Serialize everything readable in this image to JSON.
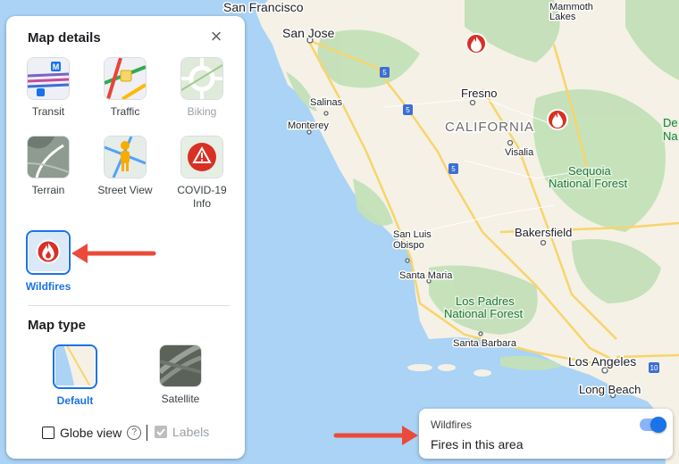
{
  "map": {
    "cities": [
      {
        "name": "San Francisco",
        "cls": "big"
      },
      {
        "name": "San Jose",
        "cls": "big"
      },
      {
        "name": "Mammoth",
        "cls": "small"
      },
      {
        "name": "Lakes",
        "cls": "small"
      },
      {
        "name": "Fresno",
        "cls": ""
      },
      {
        "name": "Salinas",
        "cls": "small"
      },
      {
        "name": "Monterey",
        "cls": "small"
      },
      {
        "name": "Visalia",
        "cls": "small"
      },
      {
        "name": "Bakersfield",
        "cls": ""
      },
      {
        "name": "San Luis",
        "cls": "small"
      },
      {
        "name": "Obispo",
        "cls": "small"
      },
      {
        "name": "Santa Maria",
        "cls": "small"
      },
      {
        "name": "Santa Barbara",
        "cls": "small"
      },
      {
        "name": "Los Angeles",
        "cls": "big"
      },
      {
        "name": "Long Beach",
        "cls": ""
      },
      {
        "name": "De",
        "cls": ""
      },
      {
        "name": "Na",
        "cls": ""
      }
    ],
    "state_label": "CALIFORNIA",
    "parks": [
      "Sequoia",
      "National Forest",
      "Los Padres",
      "National Forest"
    ],
    "highway_shields": [
      "5",
      "5",
      "5",
      "10"
    ]
  },
  "panel": {
    "title": "Map details",
    "close_glyph": "×",
    "details": [
      {
        "label": "Transit",
        "state": "normal"
      },
      {
        "label": "Traffic",
        "state": "normal"
      },
      {
        "label": "Biking",
        "state": "disabled"
      },
      {
        "label": "Terrain",
        "state": "normal"
      },
      {
        "label": "Street View",
        "state": "normal"
      },
      {
        "label": "COVID-19 Info",
        "state": "normal"
      },
      {
        "label": "Wildfires",
        "state": "active"
      }
    ],
    "map_type_title": "Map type",
    "map_types": [
      {
        "label": "Default",
        "selected": true
      },
      {
        "label": "Satellite",
        "selected": false
      }
    ],
    "globe_view": {
      "label": "Globe view",
      "checked": false,
      "help_glyph": "?"
    },
    "labels": {
      "label": "Labels",
      "checked": true,
      "disabled": true
    }
  },
  "wildfire_card": {
    "label": "Wildfires",
    "description": "Fires in this area",
    "toggle_on": true
  },
  "colors": {
    "water": "#aad3f5",
    "land": "#f5f1e6",
    "forest": "#c3e0b8",
    "highway": "#f7d56b",
    "accent": "#1a73e8",
    "fire": "#d93025",
    "annotation_arrow": "#ea4a3a"
  }
}
